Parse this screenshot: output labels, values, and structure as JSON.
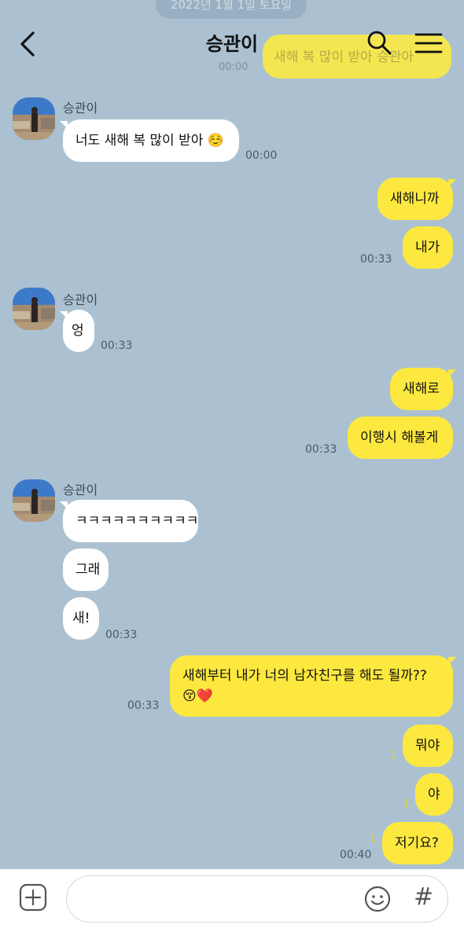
{
  "header": {
    "date_pill": "2022년 1월 1일 토요일",
    "title": "승관이"
  },
  "ghost": {
    "text": "새해 복 많이 받아 승관아",
    "time": "00:00"
  },
  "contact_name": "승관이",
  "messages": {
    "m1": {
      "text": "너도 새해 복 많이 받아 ☺️",
      "time": "00:00"
    },
    "m2": {
      "text": "새해니까"
    },
    "m3": {
      "text": "내가",
      "time": "00:33"
    },
    "m4": {
      "text": "엉",
      "time": "00:33"
    },
    "m5": {
      "text": "새해로"
    },
    "m6": {
      "text": "이행시 해볼게",
      "time": "00:33"
    },
    "m7": {
      "text": "ㅋㅋㅋㅋㅋㅋㅋㅋㅋㅋ"
    },
    "m8": {
      "text": "그래"
    },
    "m9": {
      "text": "새!",
      "time": "00:33"
    },
    "m10": {
      "text": "새해부터 내가 너의 남자친구를 해도 될까?? 😚❤️",
      "time": "00:33"
    },
    "m11": {
      "text": "뭐야",
      "unread": "1"
    },
    "m12": {
      "text": "야",
      "unread": "1"
    },
    "m13": {
      "text": "저기요?",
      "unread": "1",
      "time": "00:40"
    }
  },
  "input": {
    "value": "",
    "placeholder": ""
  },
  "icons": {
    "back": "back-arrow-icon",
    "search": "search-icon",
    "menu": "menu-icon",
    "plus": "plus-icon",
    "emoji": "emoji-icon",
    "hash": "#"
  },
  "colors": {
    "background": "#abc1d1",
    "outgoing_bubble": "#fde83f",
    "incoming_bubble": "#ffffff",
    "unread": "#e8d024"
  }
}
